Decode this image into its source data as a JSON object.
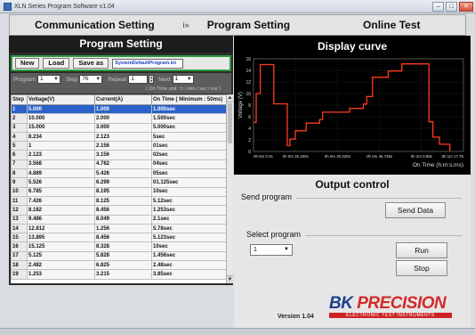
{
  "window": {
    "title": "XLN Series Program Software v1.04",
    "minimize": "–",
    "maximize": "□",
    "close": "✕"
  },
  "tabs": [
    {
      "label": "Communication Setting"
    },
    {
      "label": "i»"
    },
    {
      "label": "Program Setting"
    },
    {
      "label": "Online Test"
    }
  ],
  "program_setting": {
    "title": "Program Setting",
    "buttons": {
      "new": "New",
      "load": "Load",
      "save_as": "Save as"
    },
    "file_name": "SystemDefaultProgram.ini",
    "controls": [
      {
        "label": "Program",
        "value": "1"
      },
      {
        "label": "Step",
        "value": "76"
      },
      {
        "label": "Repeat",
        "value": "1"
      },
      {
        "label": "Next",
        "value": "1"
      }
    ],
    "hint": "( On Time unit : h / min / sec / ms )",
    "columns": [
      "Step",
      "Voltage(V)",
      "Current(A)",
      "On Time ( Minimum : 50ms)"
    ],
    "rows": [
      [
        "1",
        "5.000",
        "1.000",
        "1.000sec"
      ],
      [
        "2",
        "10.000",
        "2.000",
        "1.500sec"
      ],
      [
        "3",
        "15.000",
        "3.000",
        "5.000sec"
      ],
      [
        "4",
        "8.234",
        "2.123",
        "5sec"
      ],
      [
        "5",
        "1",
        "2.156",
        "01sec"
      ],
      [
        "6",
        "2.123",
        "3.156",
        "02sec"
      ],
      [
        "7",
        "3.568",
        "4.782",
        "04sec"
      ],
      [
        "8",
        "4.889",
        "5.426",
        "05sec"
      ],
      [
        "9",
        "5.526",
        "6.299",
        "01.125sec"
      ],
      [
        "10",
        "6.785",
        "8.195",
        "10sec"
      ],
      [
        "11",
        "7.426",
        "8.125",
        "5.12sec"
      ],
      [
        "12",
        "8.182",
        "8.456",
        "1.253sec"
      ],
      [
        "13",
        "9.486",
        "8.049",
        "2.1sec"
      ],
      [
        "14",
        "12.812",
        "1.256",
        "5.78sec"
      ],
      [
        "15",
        "13.895",
        "8.456",
        "5.123sec"
      ],
      [
        "16",
        "15.125",
        "8.328",
        "10sec"
      ],
      [
        "17",
        "5.125",
        "5.828",
        "1.456sec"
      ],
      [
        "18",
        "2.482",
        "6.825",
        "2.48sec"
      ],
      [
        "19",
        "1.253",
        "3.215",
        "3.85sec"
      ]
    ],
    "selected_row": 0,
    "scroll_up": "▲",
    "scroll_down": "▼"
  },
  "display_curve": {
    "title": "Display curve"
  },
  "chart_data": {
    "type": "line",
    "title": "Display curve",
    "xlabel": "On Time (h:m:s.ms)",
    "ylabel": "Voltage (V)",
    "ylim": [
      0,
      16
    ],
    "yticks": [
      0,
      2,
      4,
      6,
      8,
      10,
      12,
      14,
      16
    ],
    "xticks": [
      "0h 0m 0.0s",
      "0h 0m 15.180s",
      "0h 0m 30.025s",
      "0h 0m 45.745s",
      "0h 1m 0.88s",
      "0h 1m 17.76"
    ],
    "grid": true,
    "series": [
      {
        "color": "#ff3b1f",
        "points": [
          [
            0,
            5.0
          ],
          [
            1.0,
            5.0
          ],
          [
            1.0,
            10.0
          ],
          [
            2.5,
            10.0
          ],
          [
            2.5,
            15.0
          ],
          [
            7.5,
            15.0
          ],
          [
            7.5,
            8.234
          ],
          [
            12.5,
            8.234
          ],
          [
            12.5,
            1.0
          ],
          [
            13.5,
            1.0
          ],
          [
            13.5,
            2.123
          ],
          [
            15.5,
            2.123
          ],
          [
            15.5,
            3.568
          ],
          [
            19.5,
            3.568
          ],
          [
            19.5,
            4.889
          ],
          [
            24.5,
            4.889
          ],
          [
            24.5,
            5.526
          ],
          [
            25.6,
            5.526
          ],
          [
            25.6,
            6.785
          ],
          [
            35.6,
            6.785
          ],
          [
            35.6,
            7.426
          ],
          [
            40.7,
            7.426
          ],
          [
            40.7,
            8.182
          ],
          [
            42.0,
            8.182
          ],
          [
            42.0,
            9.486
          ],
          [
            44.1,
            9.486
          ],
          [
            44.1,
            12.812
          ],
          [
            49.9,
            12.812
          ],
          [
            49.9,
            13.895
          ],
          [
            55.0,
            13.895
          ],
          [
            55.0,
            15.125
          ],
          [
            65.0,
            15.125
          ],
          [
            65.0,
            5.125
          ],
          [
            66.5,
            5.125
          ],
          [
            66.5,
            2.482
          ],
          [
            68.9,
            2.482
          ],
          [
            68.9,
            1.253
          ],
          [
            72.8,
            1.253
          ],
          [
            72.8,
            0
          ]
        ]
      }
    ],
    "xlim": [
      0,
      77.8
    ]
  },
  "output_control": {
    "title": "Output control",
    "send_program_label": "Send program",
    "send_button": "Send Data",
    "select_program_label": "Select program",
    "selected_program": "1",
    "run_button": "Run",
    "stop_button": "Stop"
  },
  "brand": {
    "logo_bk": "BK",
    "logo_name": "PRECISION",
    "logo_tagline": "ELECTRONIC TEST INSTRUMENTS",
    "version": "Version 1.04"
  }
}
